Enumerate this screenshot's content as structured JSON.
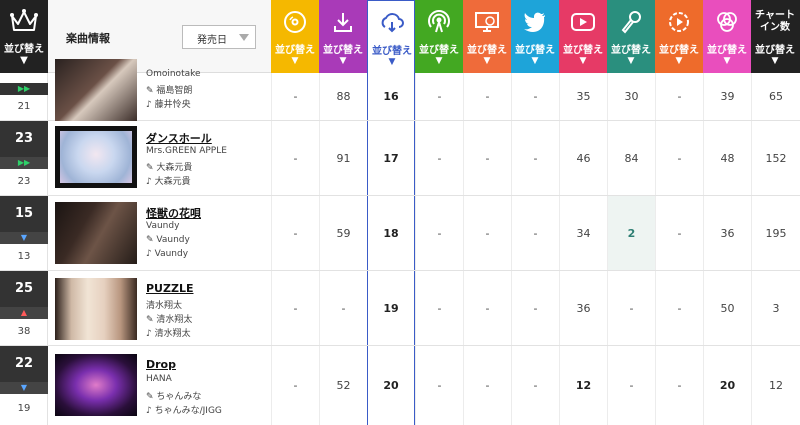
{
  "header": {
    "sort_label": "並び替え",
    "info_label": "楽曲情報",
    "release_select": "発売日",
    "chart_in_label": "チャート イン数",
    "columns": [
      {
        "icon": "cd-icon",
        "color": "#f5b800"
      },
      {
        "icon": "download-icon",
        "color": "#a93ab8"
      },
      {
        "icon": "streaming-icon",
        "color": "#3a5bc7",
        "active": true
      },
      {
        "icon": "radio-icon",
        "color": "#43a822"
      },
      {
        "icon": "pc-icon",
        "color": "#ef6b3a"
      },
      {
        "icon": "twitter-icon",
        "color": "#1ea4d9"
      },
      {
        "icon": "youtube-icon",
        "color": "#e63a66"
      },
      {
        "icon": "karaoke-icon",
        "color": "#2a8f7e"
      },
      {
        "icon": "gyao-icon",
        "color": "#ee6b2b"
      },
      {
        "icon": "tiktok-icon",
        "color": "#e94ebd"
      },
      {
        "icon": "chart-in-count",
        "color": "#222222"
      }
    ]
  },
  "rows": [
    {
      "rank": "",
      "prev": "21",
      "move": "up",
      "title": "",
      "artist": "Omoinotake",
      "credit1": "福島智朗",
      "credit2": "藤井怜央",
      "values": [
        "-",
        "88",
        "16",
        "-",
        "-",
        "-",
        "35",
        "30",
        "-",
        "39",
        "65"
      ]
    },
    {
      "rank": "23",
      "prev": "23",
      "move": "up",
      "title": "ダンスホール",
      "artist": "Mrs.GREEN APPLE",
      "credit1": "大森元貴",
      "credit2": "大森元貴",
      "values": [
        "-",
        "91",
        "17",
        "-",
        "-",
        "-",
        "46",
        "84",
        "-",
        "48",
        "152"
      ]
    },
    {
      "rank": "15",
      "prev": "13",
      "move": "down",
      "title": "怪獣の花唄",
      "artist": "Vaundy",
      "credit1": "Vaundy",
      "credit2": "Vaundy",
      "values": [
        "-",
        "59",
        "18",
        "-",
        "-",
        "-",
        "34",
        "2",
        "-",
        "36",
        "195"
      ]
    },
    {
      "rank": "25",
      "prev": "38",
      "move": "up-red",
      "title": "PUZZLE",
      "artist": "清水翔太",
      "credit1": "清水翔太",
      "credit2": "清水翔太",
      "values": [
        "-",
        "-",
        "19",
        "-",
        "-",
        "-",
        "36",
        "-",
        "-",
        "50",
        "3"
      ]
    },
    {
      "rank": "22",
      "prev": "19",
      "move": "down",
      "title": "Drop",
      "artist": "HANA",
      "credit1": "ちゃんみな",
      "credit2": "ちゃんみな/JIGG",
      "values": [
        "-",
        "52",
        "20",
        "-",
        "-",
        "-",
        "12",
        "-",
        "-",
        "20",
        "12"
      ]
    }
  ]
}
